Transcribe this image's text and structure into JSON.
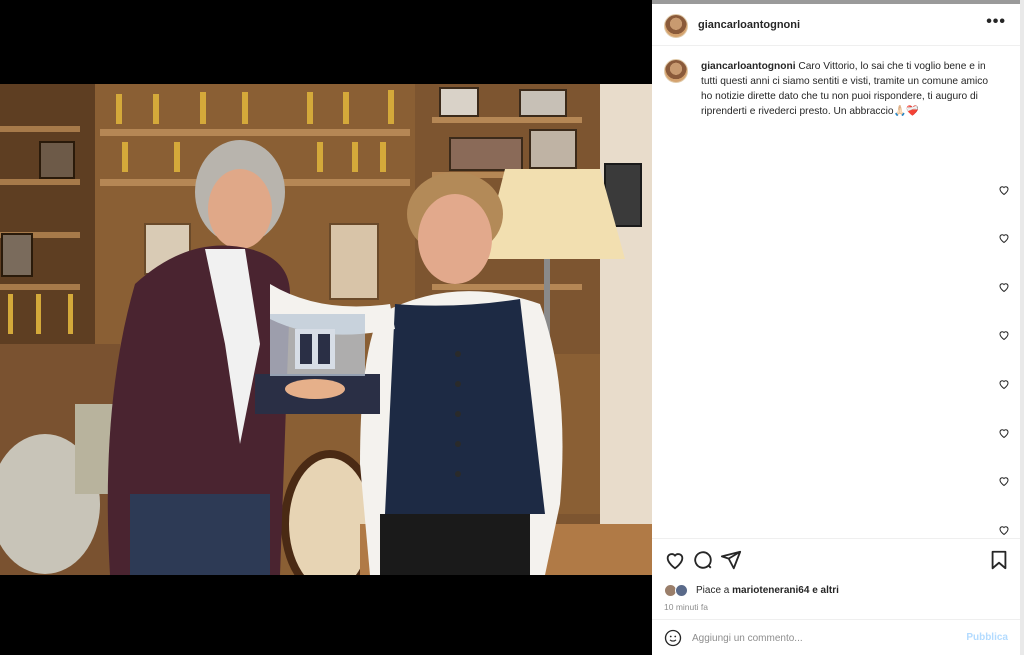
{
  "post": {
    "author": "giancarloantognoni",
    "more_icon": "more-horizontal-icon",
    "caption": {
      "author": "giancarloantognoni",
      "text": "Caro Vittorio, lo sai che ti voglio bene e in tutti questi anni ci siamo sentiti e visti, tramite un comune amico ho notizie dirette dato che tu non puoi rispondere, ti auguro di riprenderti e rivederci presto. Un abbraccio🙏🏻❤️‍🩹"
    },
    "comment_like_icons": [
      "heart-icon",
      "heart-icon",
      "heart-icon",
      "heart-icon",
      "heart-icon",
      "heart-icon",
      "heart-icon",
      "heart-icon"
    ],
    "actions": {
      "like_icon": "heart-icon",
      "comment_icon": "comment-icon",
      "share_icon": "send-icon",
      "save_icon": "bookmark-icon"
    },
    "likes": {
      "prefix": "Piace a",
      "user": "mariotenerani64",
      "suffix": "e altri"
    },
    "timestamp": "10 minuti fa",
    "comment_box": {
      "placeholder": "Aggiungi un commento...",
      "publish_label": "Pubblica"
    },
    "colors": {
      "publish_disabled": "#b3dbff",
      "text": "#262626",
      "muted": "#8e8e8e"
    }
  }
}
